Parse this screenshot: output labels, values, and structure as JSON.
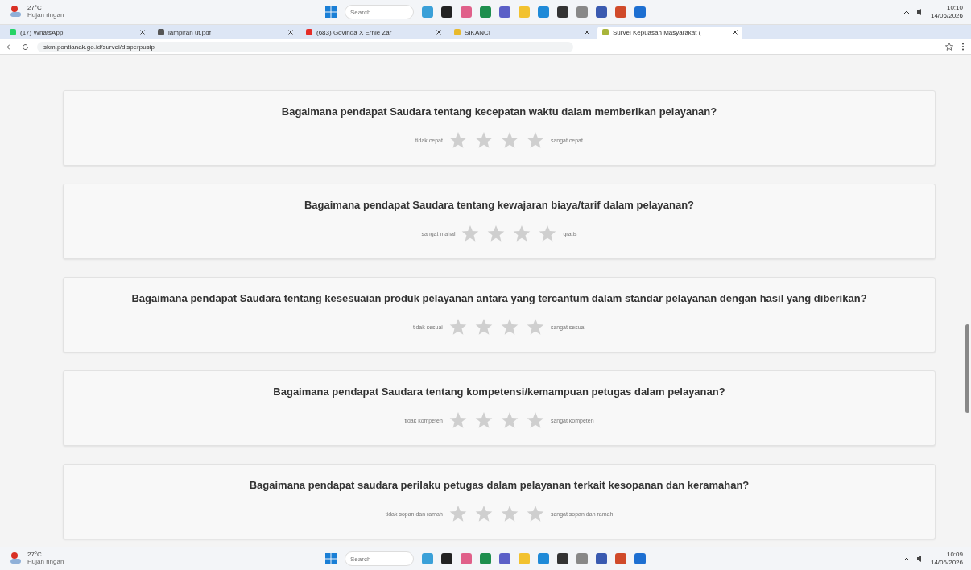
{
  "taskbars": [
    {
      "temperature": "27°C",
      "weather": "Hujan ringan",
      "search": {
        "placeholder": "Search"
      },
      "time": "10:10",
      "date": "14/06/2026"
    }
  ],
  "browser": {
    "tabs": [
      {
        "label": "(17) WhatsApp",
        "selected": false,
        "color": "#25d366"
      },
      {
        "label": "lampiran ut.pdf",
        "selected": false,
        "color": "#555555"
      },
      {
        "label": "(683) Govinda X Ernie Zar",
        "selected": false,
        "color": "#e52d27"
      },
      {
        "label": "SIKANCI",
        "selected": false,
        "color": "#e8b92c"
      },
      {
        "label": "Survei Kepuasan Masyarakat (",
        "selected": true,
        "color": "#a8b43a"
      }
    ],
    "url": "skm.pontianak.go.id/survei/disperpusip"
  },
  "questions": [
    {
      "text": "Bagaimana pendapat Saudara tentang kecepatan waktu dalam memberikan pelayanan?",
      "low": "tidak cepat",
      "high": "sangat cepat",
      "stars": 0
    },
    {
      "text": "Bagaimana pendapat Saudara tentang kewajaran biaya/tarif dalam pelayanan?",
      "low": "sangat mahal",
      "high": "gratis",
      "stars": 0
    },
    {
      "text": "Bagaimana pendapat Saudara tentang kesesuaian produk pelayanan antara yang tercantum dalam standar pelayanan dengan hasil yang diberikan?",
      "low": "tidak sesuai",
      "high": "sangat sesuai",
      "stars": 0
    },
    {
      "text": "Bagaimana pendapat Saudara tentang kompetensi/kemampuan petugas dalam pelayanan?",
      "low": "tidak kompeten",
      "high": "sangat kompeten",
      "stars": 0
    },
    {
      "text": "Bagaimana pendapat saudara perilaku petugas dalam  pelayanan terkait kesopanan dan keramahan?",
      "low": "tidak sopan dan ramah",
      "high": "sangat sopan dan ramah",
      "stars": 0
    }
  ],
  "bottom_taskbar": {
    "temperature": "27°C",
    "weather": "Hujan ringan",
    "search": {
      "placeholder": "Search"
    },
    "time": "10:09",
    "date": "14/06/2026"
  }
}
